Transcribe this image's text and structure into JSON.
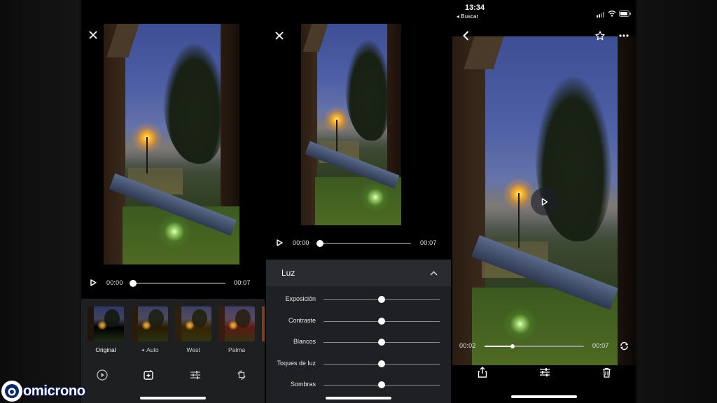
{
  "colors": {
    "panel_dark": "#1e1f21",
    "track_inactive": "#6a6a6a",
    "accent_white": "#ffffff",
    "lamp_orange": "#ffb020",
    "logo_blue": "#0a2a6a"
  },
  "editor_left": {
    "close_icon": "close-icon",
    "player": {
      "current_time": "00:00",
      "duration": "00:07",
      "progress": 0.0
    },
    "filters": [
      {
        "name": "Original",
        "selected": true,
        "tint": "#000000"
      },
      {
        "name": "Auto",
        "prefix_icon": "sparkle-icon",
        "selected": false,
        "tint": "#2a1a00"
      },
      {
        "name": "West",
        "selected": false,
        "tint": "#3a2400"
      },
      {
        "name": "Palma",
        "selected": false,
        "tint": "#5a1a10"
      }
    ],
    "tools": [
      "play-circle-icon",
      "add-photo-icon",
      "sliders-icon",
      "crop-rotate-icon"
    ]
  },
  "editor_middle": {
    "close_icon": "close-icon",
    "player": {
      "current_time": "00:00",
      "duration": "00:07",
      "progress": 0.0
    },
    "section_title": "Luz",
    "adjustments": [
      {
        "label": "Exposición",
        "value": 0.5
      },
      {
        "label": "Contraste",
        "value": 0.5
      },
      {
        "label": "Blancos",
        "value": 0.5
      },
      {
        "label": "Toques de luz",
        "value": 0.5
      },
      {
        "label": "Sombras",
        "value": 0.5
      }
    ]
  },
  "viewer_right": {
    "status": {
      "time": "13:34",
      "back_app": "◂ Buscar"
    },
    "player": {
      "current_time": "00:02",
      "duration": "00:07",
      "progress": 0.28
    },
    "actions": [
      "share-icon",
      "sliders-icon",
      "trash-icon"
    ]
  },
  "watermark": {
    "text": "omicrono"
  }
}
